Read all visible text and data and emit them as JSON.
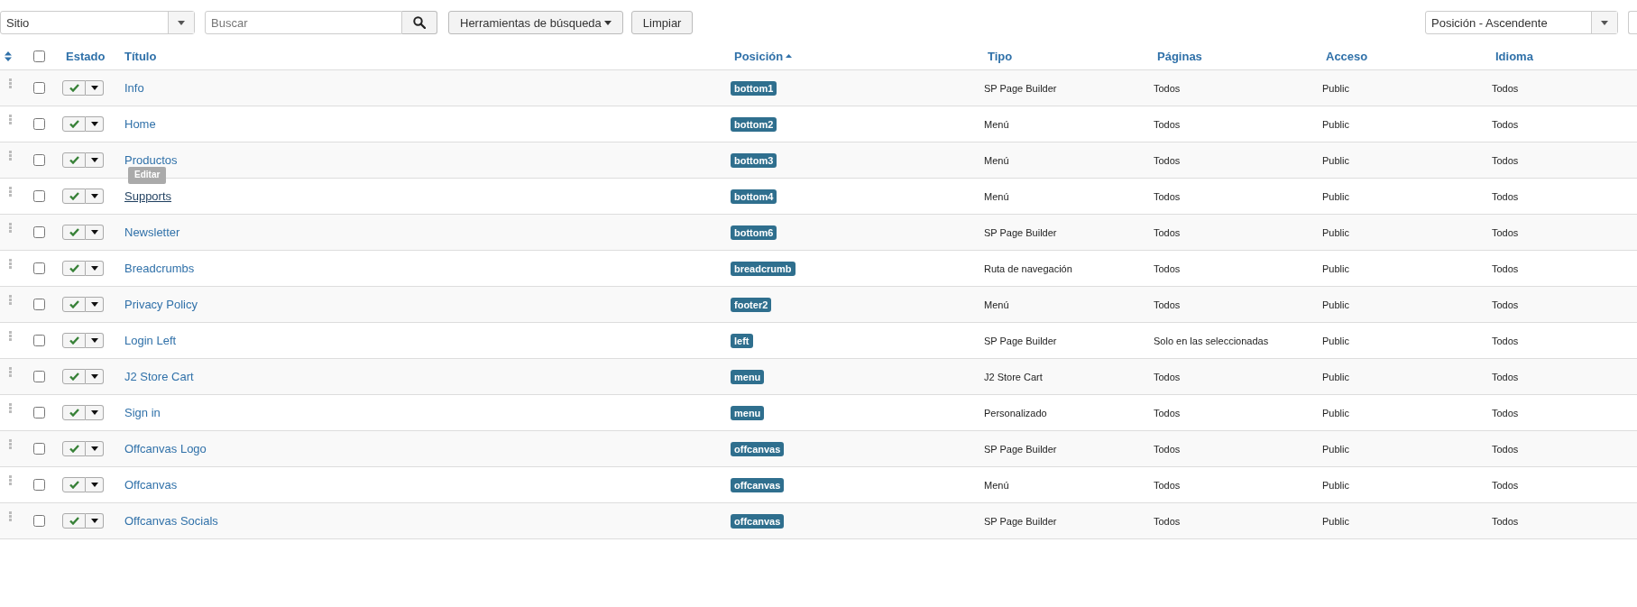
{
  "toolbar": {
    "client_select": "Sitio",
    "search": {
      "placeholder": "Buscar"
    },
    "tools_button": "Herramientas de búsqueda",
    "clear_button": "Limpiar",
    "sort_select": "Posición - Ascendente"
  },
  "table": {
    "columns": [
      {
        "label": "Estado",
        "sorted": false
      },
      {
        "label": "Título",
        "sorted": false
      },
      {
        "label": "Posición",
        "sorted": true
      },
      {
        "label": "Tipo",
        "sorted": false
      },
      {
        "label": "Páginas",
        "sorted": false
      },
      {
        "label": "Acceso",
        "sorted": false
      },
      {
        "label": "Idioma",
        "sorted": false
      }
    ],
    "select_all": false,
    "rows": [
      {
        "checked": false,
        "published": true,
        "title": "Info",
        "hovered": false,
        "position": "bottom1",
        "type": "SP Page Builder",
        "pages": "Todos",
        "access": "Public",
        "language": "Todos"
      },
      {
        "checked": false,
        "published": true,
        "title": "Home",
        "hovered": false,
        "position": "bottom2",
        "type": "Menú",
        "pages": "Todos",
        "access": "Public",
        "language": "Todos"
      },
      {
        "checked": false,
        "published": true,
        "title": "Productos",
        "hovered": false,
        "position": "bottom3",
        "type": "Menú",
        "pages": "Todos",
        "access": "Public",
        "language": "Todos"
      },
      {
        "checked": false,
        "published": true,
        "title": "Supports",
        "hovered": true,
        "tooltip": "Editar",
        "position": "bottom4",
        "type": "Menú",
        "pages": "Todos",
        "access": "Public",
        "language": "Todos"
      },
      {
        "checked": false,
        "published": true,
        "title": "Newsletter",
        "hovered": false,
        "position": "bottom6",
        "type": "SP Page Builder",
        "pages": "Todos",
        "access": "Public",
        "language": "Todos"
      },
      {
        "checked": false,
        "published": true,
        "title": "Breadcrumbs",
        "hovered": false,
        "position": "breadcrumb",
        "type": "Ruta de navegación",
        "pages": "Todos",
        "access": "Public",
        "language": "Todos"
      },
      {
        "checked": false,
        "published": true,
        "title": "Privacy Policy",
        "hovered": false,
        "position": "footer2",
        "type": "Menú",
        "pages": "Todos",
        "access": "Public",
        "language": "Todos"
      },
      {
        "checked": false,
        "published": true,
        "title": "Login Left",
        "hovered": false,
        "position": "left",
        "type": "SP Page Builder",
        "pages": "Solo en las seleccionadas",
        "access": "Public",
        "language": "Todos"
      },
      {
        "checked": false,
        "published": true,
        "title": "J2 Store Cart",
        "hovered": false,
        "position": "menu",
        "type": "J2 Store Cart",
        "pages": "Todos",
        "access": "Public",
        "language": "Todos"
      },
      {
        "checked": false,
        "published": true,
        "title": "Sign in",
        "hovered": false,
        "position": "menu",
        "type": "Personalizado",
        "pages": "Todos",
        "access": "Public",
        "language": "Todos"
      },
      {
        "checked": false,
        "published": true,
        "title": "Offcanvas Logo",
        "hovered": false,
        "position": "offcanvas",
        "type": "SP Page Builder",
        "pages": "Todos",
        "access": "Public",
        "language": "Todos"
      },
      {
        "checked": false,
        "published": true,
        "title": "Offcanvas",
        "hovered": false,
        "position": "offcanvas",
        "type": "Menú",
        "pages": "Todos",
        "access": "Public",
        "language": "Todos"
      },
      {
        "checked": false,
        "published": true,
        "title": "Offcanvas Socials",
        "hovered": false,
        "position": "offcanvas",
        "type": "SP Page Builder",
        "pages": "Todos",
        "access": "Public",
        "language": "Todos"
      }
    ]
  }
}
